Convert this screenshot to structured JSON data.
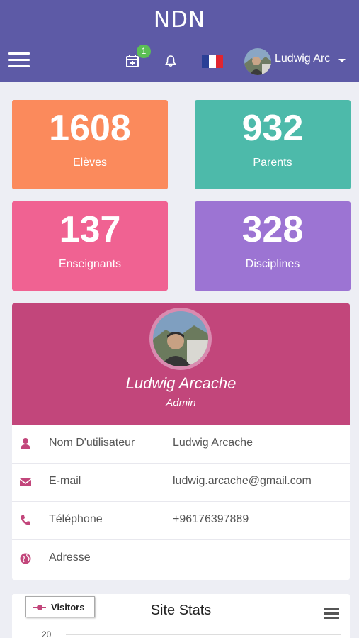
{
  "header": {
    "title": "NDN",
    "notification_count": "1",
    "user_short_name": "Ludwig Arc",
    "icons": [
      "menu-icon",
      "calendar-plus-icon",
      "bell-icon",
      "france-flag-icon",
      "avatar",
      "caret-down-icon"
    ],
    "colors": {
      "bar": "#5d5aa6",
      "badge": "#5bbf55"
    }
  },
  "stats": [
    {
      "value": "1608",
      "label": "Elèves",
      "color": "#fb8a5c"
    },
    {
      "value": "932",
      "label": "Parents",
      "color": "#4dbaaa"
    },
    {
      "value": "137",
      "label": "Enseignants",
      "color": "#f06292"
    },
    {
      "value": "328",
      "label": "Disciplines",
      "color": "#9c74d3"
    }
  ],
  "profile": {
    "name": "Ludwig Arcache",
    "role": "Admin",
    "accent": "#c2467b",
    "fields": [
      {
        "icon": "user-icon",
        "key": "Nom D'utilisateur",
        "value": "Ludwig Arcache"
      },
      {
        "icon": "envelope-icon",
        "key": "E-mail",
        "value": "ludwig.arcache@gmail.com"
      },
      {
        "icon": "phone-icon",
        "key": "Téléphone",
        "value": "+96176397889"
      },
      {
        "icon": "globe-icon",
        "key": "Adresse",
        "value": ""
      }
    ]
  },
  "site_stats": {
    "title": "Site Stats",
    "legend_label": "Visitors",
    "first_tick": "20"
  }
}
